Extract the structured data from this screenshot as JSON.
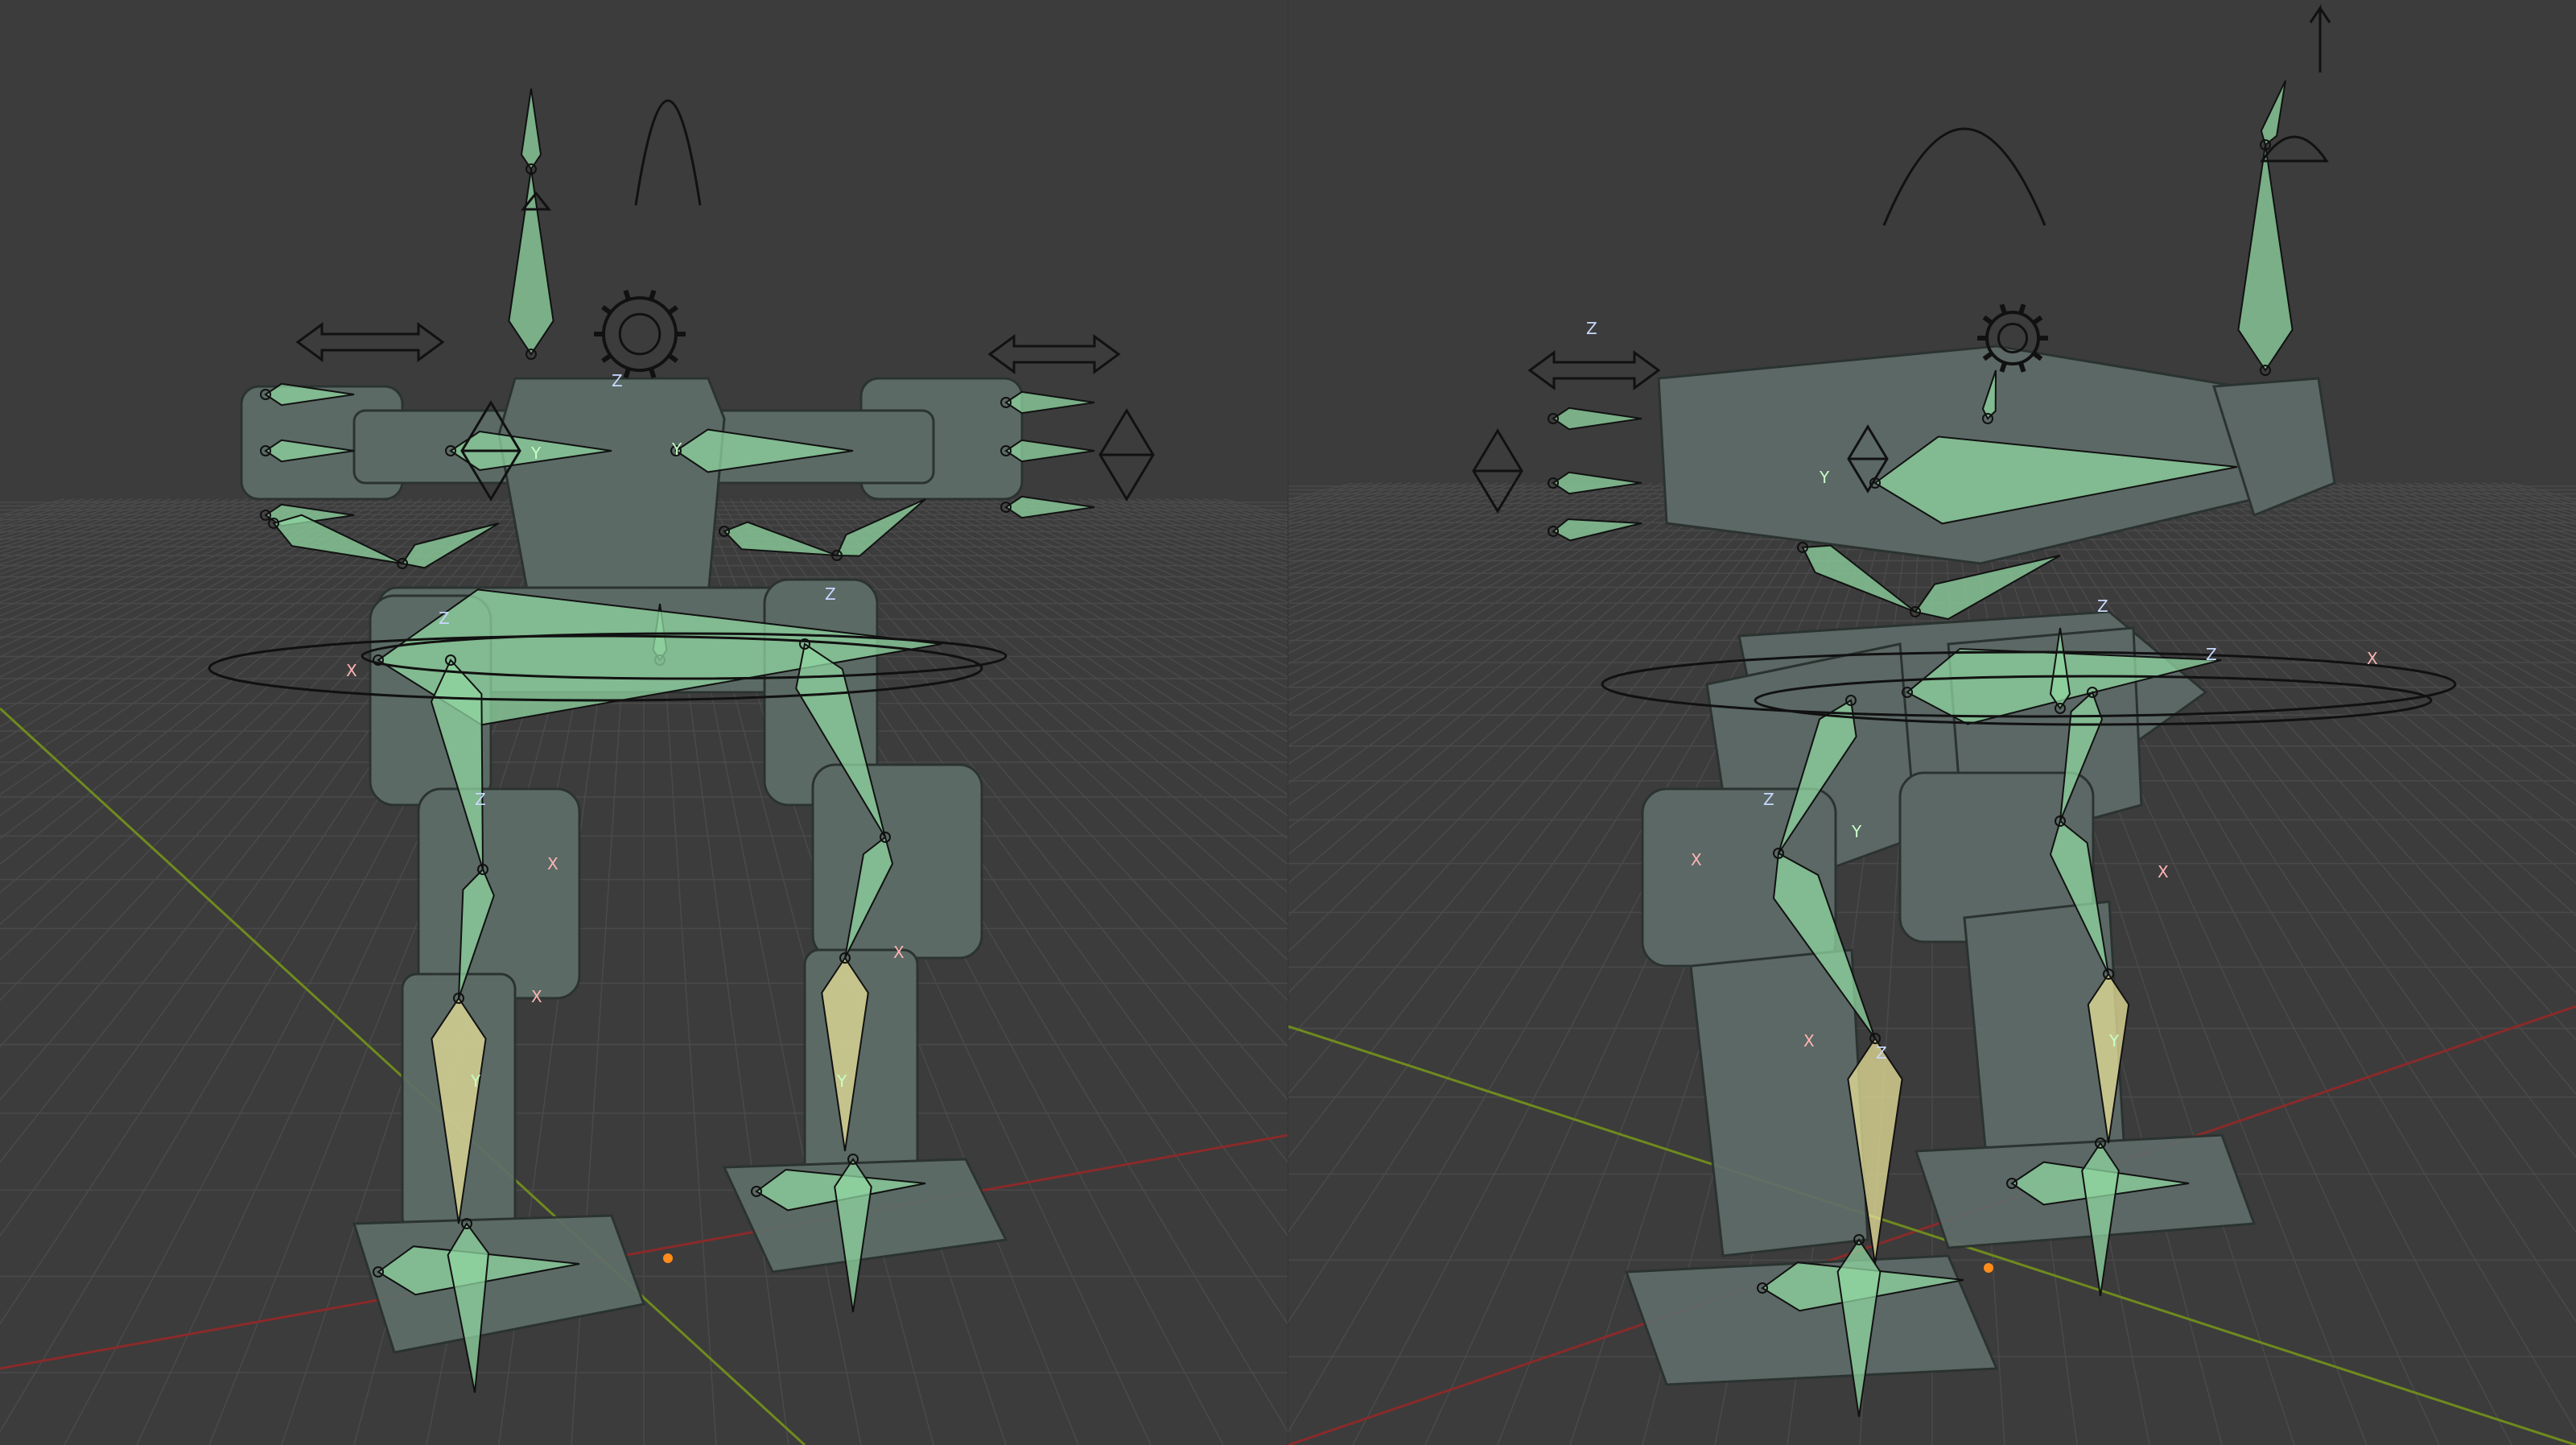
{
  "scene": {
    "background": "#3c3c3c",
    "grid_color": "#4a4a4a",
    "x_axis_color": "#8a2a2a",
    "y_axis_color": "#6f8a1e",
    "origin_color": "#ff8c1a",
    "bone_fill": "#8fd6a0",
    "bone_select_fill": "#e8e29a",
    "mesh_color": "#5f6f6a"
  },
  "viewports": [
    {
      "id": "left",
      "view": "front",
      "axis_labels": [
        "X",
        "Y",
        "Z",
        "X",
        "Y",
        "Z",
        "X",
        "Z",
        "Y",
        "X",
        "Z",
        "Y"
      ]
    },
    {
      "id": "right",
      "view": "perspective",
      "axis_labels": [
        "Z",
        "X",
        "Z",
        "Y",
        "X",
        "Z",
        "Y",
        "X",
        "Z",
        "Y",
        "Z",
        "X"
      ]
    }
  ]
}
